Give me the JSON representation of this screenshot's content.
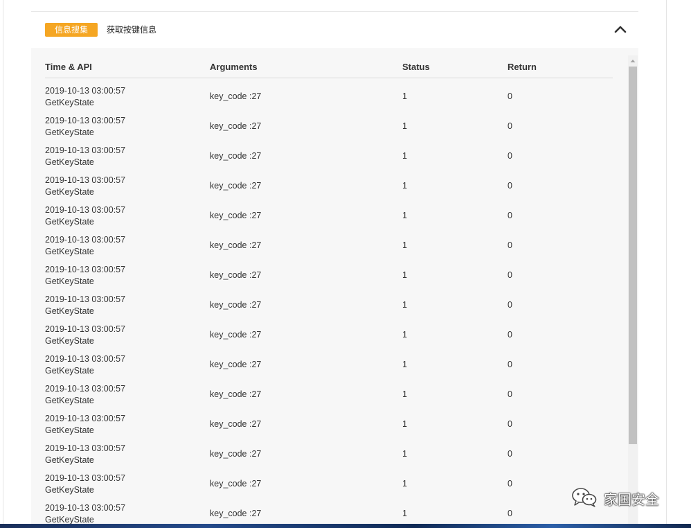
{
  "section": {
    "tag": "信息搜集",
    "title": "获取按键信息"
  },
  "table": {
    "headers": {
      "time_api": "Time & API",
      "arguments": "Arguments",
      "status": "Status",
      "return": "Return"
    },
    "rows": [
      {
        "time": "2019-10-13 03:00:57",
        "api": "GetKeyState",
        "args": "key_code :27",
        "status": "1",
        "ret": "0"
      },
      {
        "time": "2019-10-13 03:00:57",
        "api": "GetKeyState",
        "args": "key_code :27",
        "status": "1",
        "ret": "0"
      },
      {
        "time": "2019-10-13 03:00:57",
        "api": "GetKeyState",
        "args": "key_code :27",
        "status": "1",
        "ret": "0"
      },
      {
        "time": "2019-10-13 03:00:57",
        "api": "GetKeyState",
        "args": "key_code :27",
        "status": "1",
        "ret": "0"
      },
      {
        "time": "2019-10-13 03:00:57",
        "api": "GetKeyState",
        "args": "key_code :27",
        "status": "1",
        "ret": "0"
      },
      {
        "time": "2019-10-13 03:00:57",
        "api": "GetKeyState",
        "args": "key_code :27",
        "status": "1",
        "ret": "0"
      },
      {
        "time": "2019-10-13 03:00:57",
        "api": "GetKeyState",
        "args": "key_code :27",
        "status": "1",
        "ret": "0"
      },
      {
        "time": "2019-10-13 03:00:57",
        "api": "GetKeyState",
        "args": "key_code :27",
        "status": "1",
        "ret": "0"
      },
      {
        "time": "2019-10-13 03:00:57",
        "api": "GetKeyState",
        "args": "key_code :27",
        "status": "1",
        "ret": "0"
      },
      {
        "time": "2019-10-13 03:00:57",
        "api": "GetKeyState",
        "args": "key_code :27",
        "status": "1",
        "ret": "0"
      },
      {
        "time": "2019-10-13 03:00:57",
        "api": "GetKeyState",
        "args": "key_code :27",
        "status": "1",
        "ret": "0"
      },
      {
        "time": "2019-10-13 03:00:57",
        "api": "GetKeyState",
        "args": "key_code :27",
        "status": "1",
        "ret": "0"
      },
      {
        "time": "2019-10-13 03:00:57",
        "api": "GetKeyState",
        "args": "key_code :27",
        "status": "1",
        "ret": "0"
      },
      {
        "time": "2019-10-13 03:00:57",
        "api": "GetKeyState",
        "args": "key_code :27",
        "status": "1",
        "ret": "0"
      },
      {
        "time": "2019-10-13 03:00:57",
        "api": "GetKeyState",
        "args": "key_code :27",
        "status": "1",
        "ret": "0"
      }
    ]
  },
  "watermark": {
    "text": "家国安全",
    "icon": "wechat-icon"
  },
  "icons": {
    "collapse": "chevron-up-icon",
    "scroll_up": "scroll-up-arrow-icon"
  },
  "colors": {
    "tag_background": "#f5a623",
    "table_background": "#f7f7f7",
    "scroll_thumb": "#c1c1c1"
  }
}
